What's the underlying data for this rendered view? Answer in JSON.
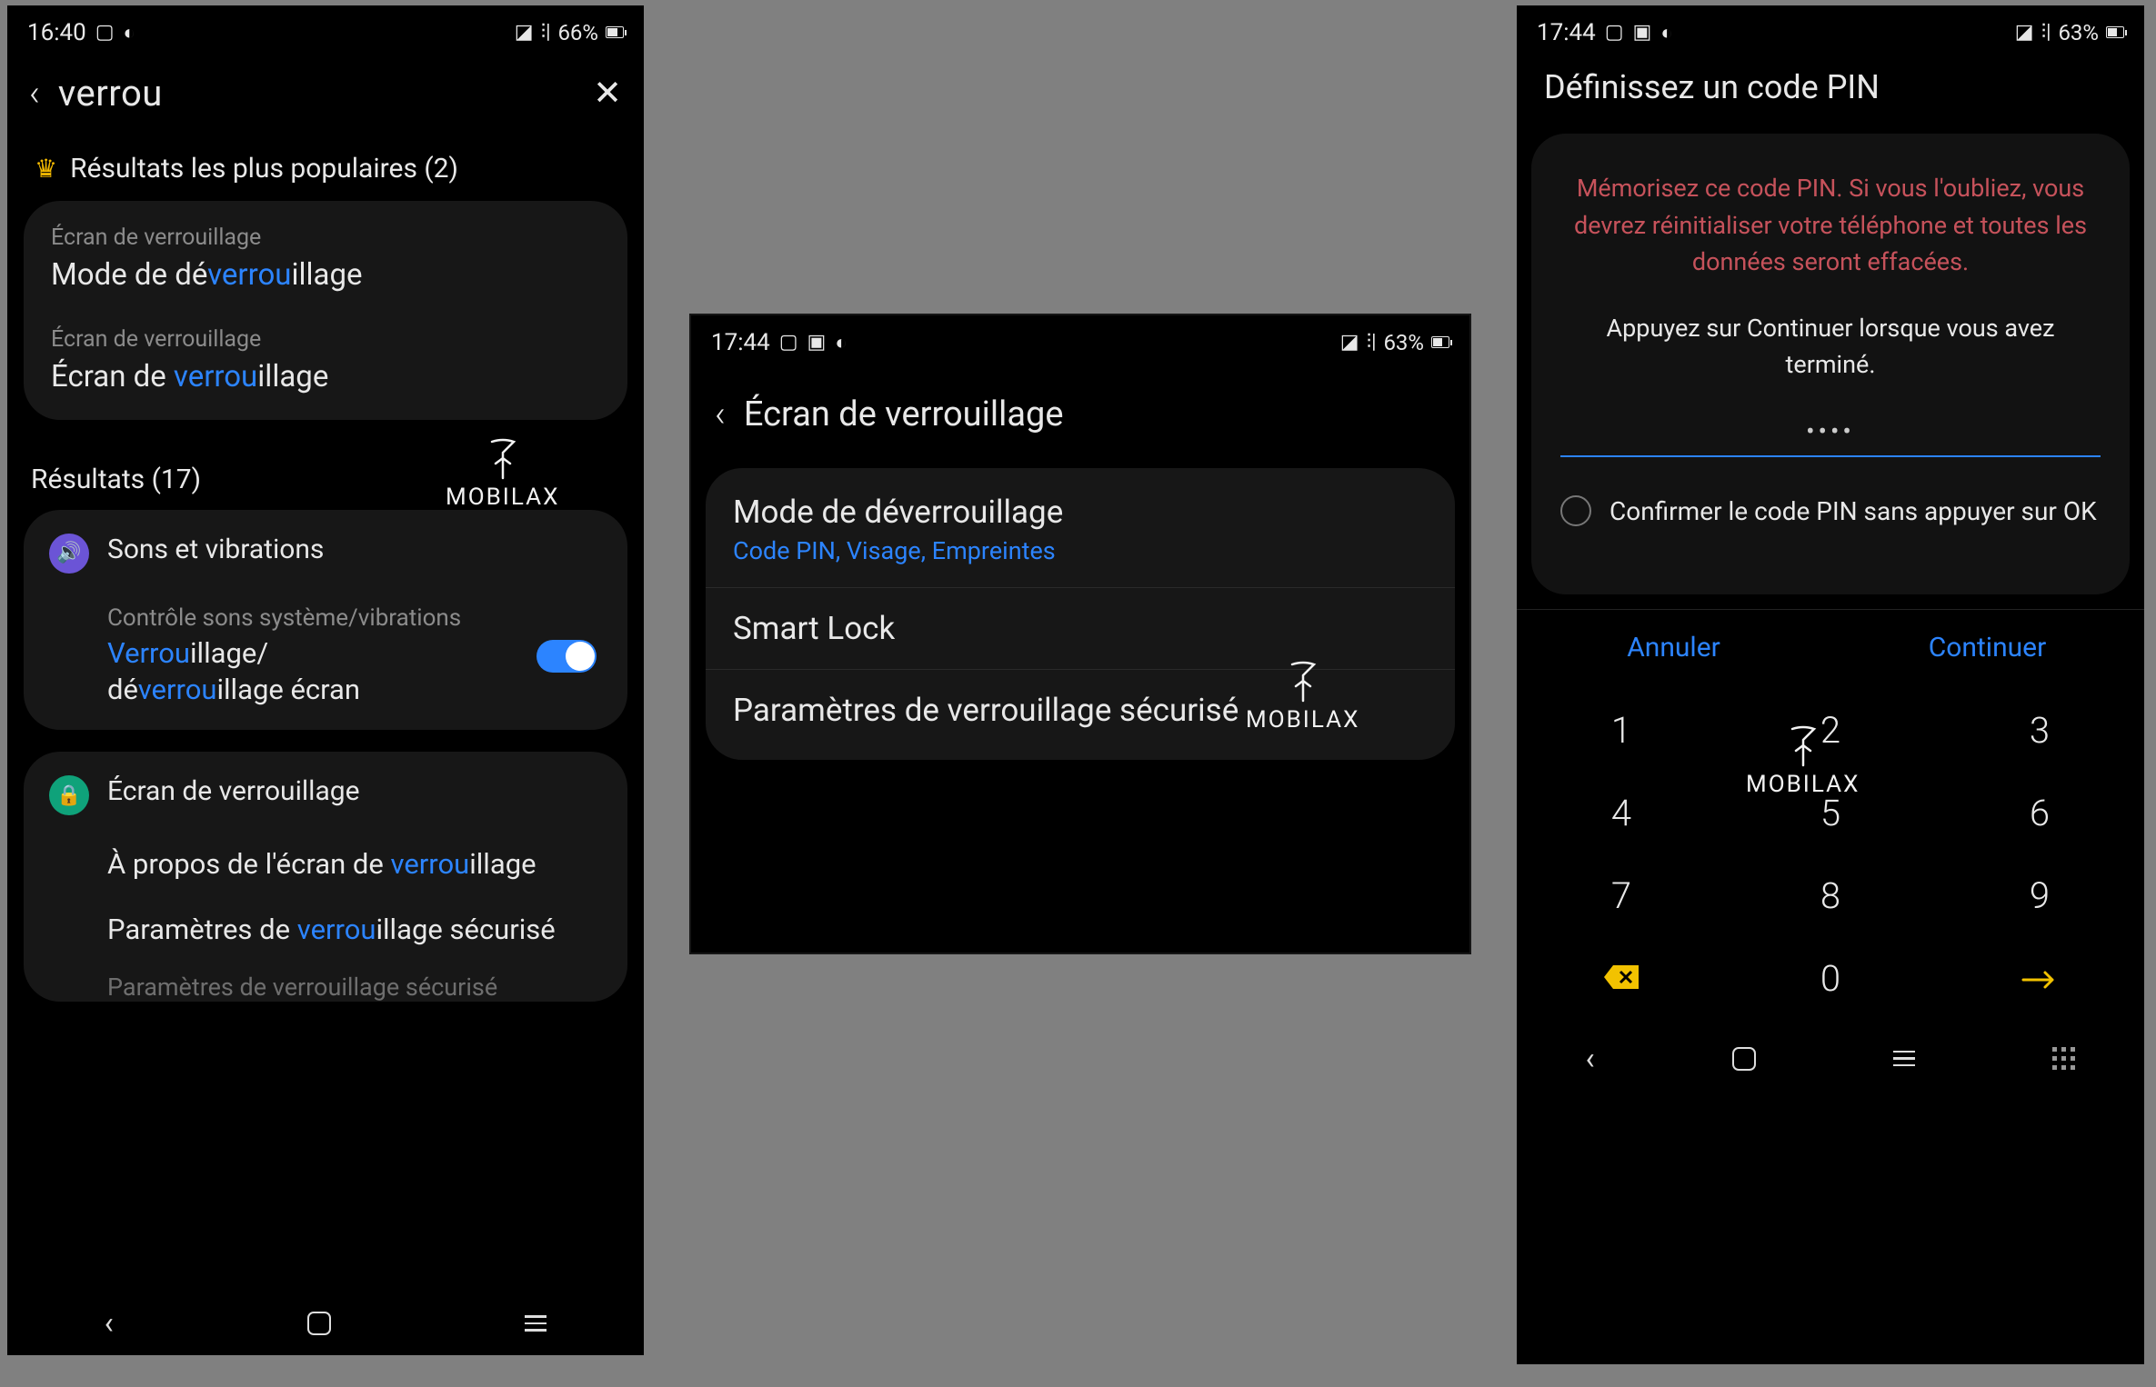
{
  "watermark": "MOBILAX",
  "phone1": {
    "status": {
      "time": "16:40",
      "battery": "66%"
    },
    "search_term": "verrou",
    "popular_heading": "Résultats les plus populaires (2)",
    "popular": [
      {
        "eyebrow": "Écran de verrouillage",
        "title_pre": "Mode de dé",
        "title_hl": "verrou",
        "title_post": "illage"
      },
      {
        "eyebrow": "Écran de verrouillage",
        "title_pre": "Écran de ",
        "title_hl": "verrou",
        "title_post": "illage"
      }
    ],
    "results_heading": "Résultats (17)",
    "group1": {
      "header": "Sons et vibrations",
      "sub_eyebrow": "Contrôle sons système/vibrations",
      "sub_line1_hl": "Verrou",
      "sub_line1_post": "illage/",
      "sub_line2_pre": "dé",
      "sub_line2_hl": "verrou",
      "sub_line2_post": "illage écran",
      "toggle_on": true
    },
    "group2": {
      "header": "Écran de verrouillage",
      "item1_pre": "À propos de l'écran de ",
      "item1_hl": "verrou",
      "item1_post": "illage",
      "item2_pre": "Paramètres de ",
      "item2_hl": "verrou",
      "item2_post": "illage sécurisé",
      "faded": "Paramètres de verrouillage sécurisé"
    }
  },
  "phone2": {
    "status": {
      "time": "17:44",
      "battery": "63%"
    },
    "header_title": "Écran de verrouillage",
    "menu": [
      {
        "title": "Mode de déverrouillage",
        "subtitle": "Code PIN, Visage, Empreintes"
      },
      {
        "title": "Smart Lock",
        "subtitle": ""
      },
      {
        "title": "Paramètres de verrouillage sécurisé",
        "subtitle": ""
      }
    ]
  },
  "phone3": {
    "status": {
      "time": "17:44",
      "battery": "63%"
    },
    "title": "Définissez un code PIN",
    "warning": "Mémorisez ce code PIN. Si vous l'oubliez, vous devrez réinitialiser votre téléphone et toutes les données seront effacées.",
    "instruction": "Appuyez sur Continuer lorsque vous avez terminé.",
    "pin_display": "••••",
    "radio_label": "Confirmer le code PIN sans appuyer sur OK",
    "cancel": "Annuler",
    "continue": "Continuer",
    "keys": [
      "1",
      "2",
      "3",
      "4",
      "5",
      "6",
      "7",
      "8",
      "9"
    ],
    "key_zero": "0"
  }
}
